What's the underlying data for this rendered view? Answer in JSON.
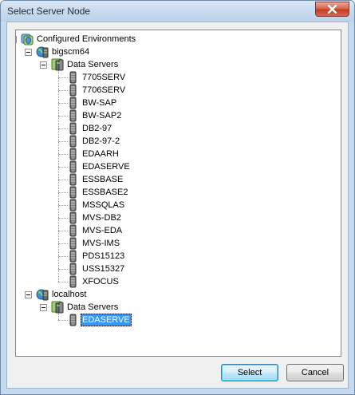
{
  "window": {
    "title": "Select Server Node"
  },
  "tree": {
    "root": "Configured Environments",
    "nodes": [
      {
        "name": "bigscm64",
        "group": "Data Servers",
        "servers": [
          "7705SERV",
          "7706SERV",
          "BW-SAP",
          "BW-SAP2",
          "DB2-97",
          "DB2-97-2",
          "EDAARH",
          "EDASERVE",
          "ESSBASE",
          "ESSBASE2",
          "MSSQLAS",
          "MVS-DB2",
          "MVS-EDA",
          "MVS-IMS",
          "PDS15123",
          "USS15327",
          "XFOCUS"
        ]
      },
      {
        "name": "localhost",
        "group": "Data Servers",
        "servers": [
          "EDASERVE"
        ],
        "selected": "EDASERVE"
      }
    ]
  },
  "buttons": {
    "select": "Select",
    "cancel": "Cancel"
  },
  "colors": {
    "selection": "#3399ff",
    "globe": "#3a8ed8",
    "server": "#5a5a5a"
  }
}
